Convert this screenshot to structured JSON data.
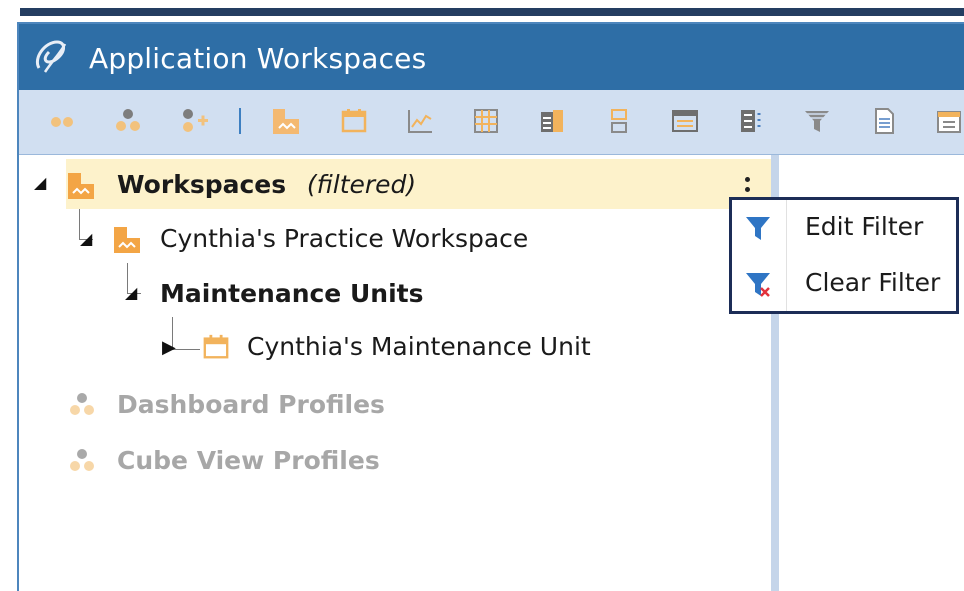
{
  "window": {
    "title": "Application Workspaces"
  },
  "toolbar": {
    "buttons": [
      "two-dots-icon",
      "group-icon",
      "add-group-icon",
      "workspace-icon",
      "maintenance-unit-icon",
      "line-chart-icon",
      "grid-icon",
      "component-icon",
      "stacked-boxes-icon",
      "dashboard-icon",
      "data-list-icon",
      "filter-icon",
      "document-icon",
      "calendar-icon"
    ]
  },
  "tree": {
    "root": {
      "label": "Workspaces",
      "suffix": "(filtered)"
    },
    "workspace": {
      "label": "Cynthia's Practice Workspace"
    },
    "group": {
      "label": "Maintenance Units"
    },
    "unit": {
      "label": "Cynthia's Maintenance Unit"
    },
    "dashboard_profiles": {
      "label": "Dashboard Profiles"
    },
    "cube_view_profiles": {
      "label": "Cube View Profiles"
    }
  },
  "context_menu": {
    "items": [
      {
        "label": "Edit Filter",
        "icon": "filter-icon"
      },
      {
        "label": "Clear Filter",
        "icon": "clear-filter-icon"
      }
    ]
  },
  "colors": {
    "titlebar": "#2e6ea6",
    "toolbar": "#d1dff1",
    "selection": "#fdf2cb",
    "accent_orange": "#f3a545",
    "menu_border": "#1c2d57"
  }
}
